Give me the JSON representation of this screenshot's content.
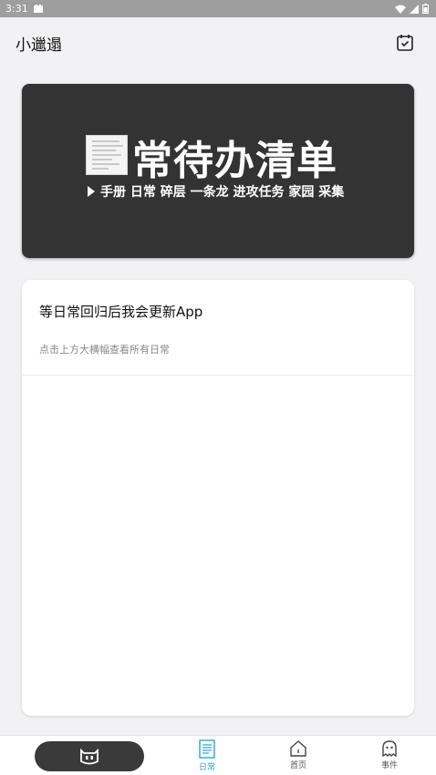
{
  "status_bar": {
    "time": "3:31"
  },
  "app_bar": {
    "title": "小邋遢",
    "action_icon": "calendar-check-icon"
  },
  "banner": {
    "headline": "常待办清单",
    "subtitle": "手册 日常 碎层 一条龙 进攻任务 家园 采集"
  },
  "card": {
    "title": "等日常回归后我会更新App",
    "hint": "点击上方大横幅查看所有日常"
  },
  "bottom_nav": {
    "items": [
      {
        "label": "",
        "icon": "mascot-face-icon"
      },
      {
        "label": "日常",
        "icon": "document-list-icon",
        "active": true
      },
      {
        "label": "首页",
        "icon": "home-icon"
      },
      {
        "label": "事件",
        "icon": "ghost-icon"
      }
    ],
    "accent": "#2aa0e0"
  },
  "colors": {
    "banner_bg": "#333333",
    "page_bg": "#f2f2f4"
  }
}
